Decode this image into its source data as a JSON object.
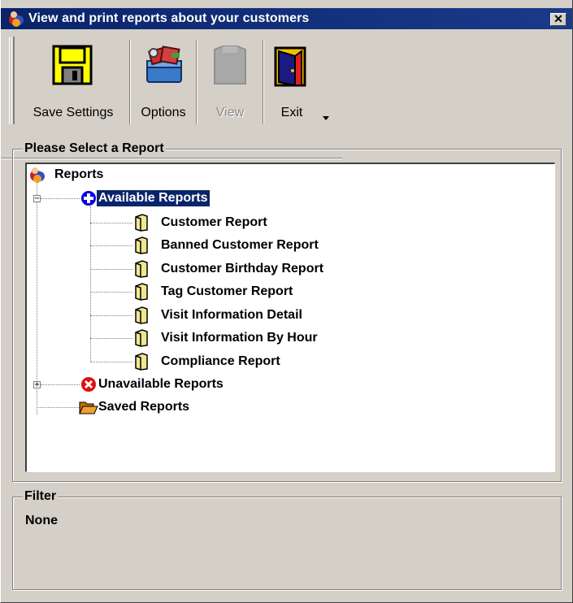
{
  "window": {
    "title": "View and print reports about your customers",
    "close_glyph": "✕"
  },
  "toolbar": {
    "buttons": [
      {
        "label": "Save Settings",
        "icon": "floppy-disk-icon",
        "enabled": true
      },
      {
        "label": "Options",
        "icon": "options-toolbox-icon",
        "enabled": true
      },
      {
        "label": "View",
        "icon": "view-document-icon",
        "enabled": false
      },
      {
        "label": "Exit",
        "icon": "exit-door-icon",
        "enabled": true
      }
    ]
  },
  "report_group": {
    "label": "Please Select a Report",
    "tree": {
      "root": "Reports",
      "available": {
        "label": "Available Reports",
        "expanded": true,
        "selected": true,
        "items": [
          "Customer Report",
          "Banned Customer Report",
          "Customer Birthday Report",
          "Tag Customer Report",
          "Visit Information Detail",
          "Visit Information By Hour",
          "Compliance Report"
        ]
      },
      "unavailable": {
        "label": "Unavailable Reports",
        "expanded": false
      },
      "saved": {
        "label": "Saved Reports"
      }
    }
  },
  "filter_group": {
    "label": "Filter",
    "value": "None"
  },
  "colors": {
    "titlebar": "#0a246a",
    "selection": "#0a246a",
    "face": "#d4d0c8",
    "floppy_yellow": "#ffff00",
    "available_blue": "#0000e0",
    "unavailable_red": "#e01010"
  }
}
